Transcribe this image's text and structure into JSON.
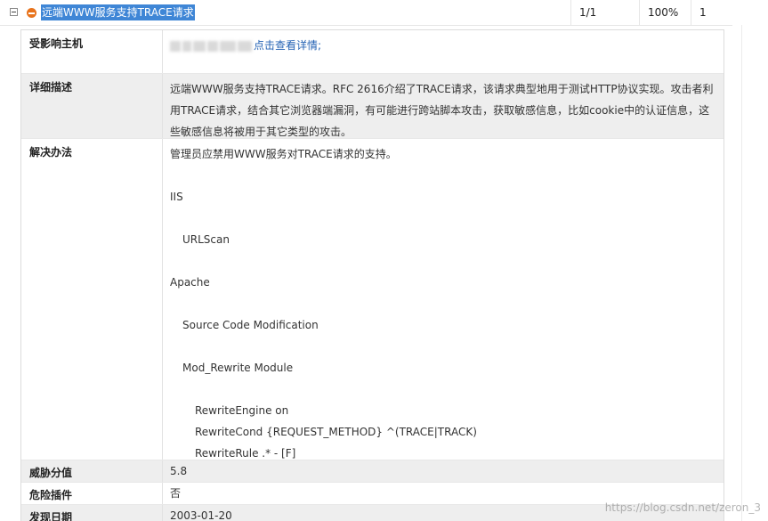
{
  "vuln": {
    "title": "远端WWW服务支持TRACE请求",
    "count": "1/1",
    "percent": "100%",
    "index": "1",
    "severity_color": "#e8731c"
  },
  "labels": {
    "host": "受影响主机",
    "description": "详细描述",
    "solution": "解决办法",
    "score": "威胁分值",
    "plugin": "危险插件",
    "date": "发现日期"
  },
  "host": {
    "link": "点击查看详情;"
  },
  "description": "远端WWW服务支持TRACE请求。RFC 2616介绍了TRACE请求，该请求典型地用于测试HTTP协议实现。攻击者利用TRACE请求，结合其它浏览器端漏洞，有可能进行跨站脚本攻击，获取敏感信息，比如cookie中的认证信息，这些敏感信息将被用于其它类型的攻击。",
  "solution": {
    "line0": "管理员应禁用WWW服务对TRACE请求的支持。",
    "line1": "IIS",
    "line2": "URLScan",
    "line3": "Apache",
    "line4": "Source Code Modification",
    "line5": "Mod_Rewrite Module",
    "line6": "RewriteEngine on",
    "line7": "RewriteCond {REQUEST_METHOD} ^(TRACE|TRACK)",
    "line8": "RewriteRule .* - [F]"
  },
  "score": "5.8",
  "plugin": "否",
  "date": "2003-01-20",
  "watermark": "https://blog.csdn.net/zeron_3"
}
